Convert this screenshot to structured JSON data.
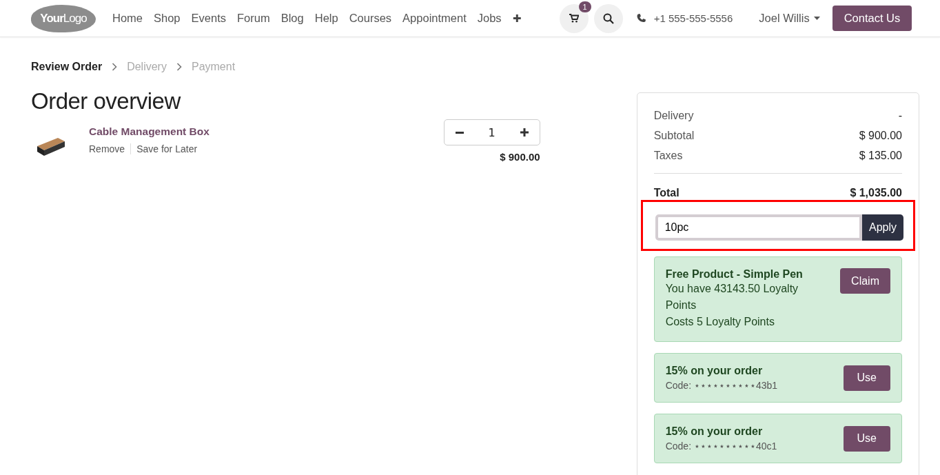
{
  "header": {
    "logo": {
      "word1": "Your",
      "word2": "Logo"
    },
    "nav": [
      "Home",
      "Shop",
      "Events",
      "Forum",
      "Blog",
      "Help",
      "Courses",
      "Appointment",
      "Jobs"
    ],
    "add_icon": "✚",
    "cart_count": "1",
    "phone": "+1 555-555-5556",
    "user": "Joel Willis",
    "contact_button": "Contact Us"
  },
  "steps": [
    {
      "label": "Review Order",
      "selected": true
    },
    {
      "label": "Delivery",
      "selected": false
    },
    {
      "label": "Payment",
      "selected": false
    }
  ],
  "title": "Order overview",
  "lines": [
    {
      "name": "Cable Management Box",
      "actions": [
        "Remove",
        "Save for Later"
      ],
      "quantity": "1",
      "price": "$ 900.00"
    }
  ],
  "summary": {
    "rows": [
      {
        "label": "Delivery",
        "value": "-"
      },
      {
        "label": "Subtotal",
        "value": "$ 900.00"
      },
      {
        "label": "Taxes",
        "value": "$ 135.00"
      }
    ],
    "total": {
      "label": "Total",
      "value": "$ 1,035.00"
    },
    "coupon": {
      "value": "10pc",
      "button": "Apply",
      "highlighted": true
    },
    "rewards": [
      {
        "kind": "loyalty",
        "title": "Free Product - Simple Pen",
        "lines": [
          "You have 43143.50 Loyalty Points",
          "Costs 5 Loyalty Points"
        ],
        "button": "Claim"
      },
      {
        "kind": "code",
        "title": "15% on your order",
        "code_label": "Code:",
        "code": "⋆⋆⋆⋆⋆⋆⋆⋆⋆⋆43b1",
        "button": "Use"
      },
      {
        "kind": "code",
        "title": "15% on your order",
        "code_label": "Code:",
        "code": "⋆⋆⋆⋆⋆⋆⋆⋆⋆⋆40c1",
        "button": "Use"
      }
    ]
  }
}
